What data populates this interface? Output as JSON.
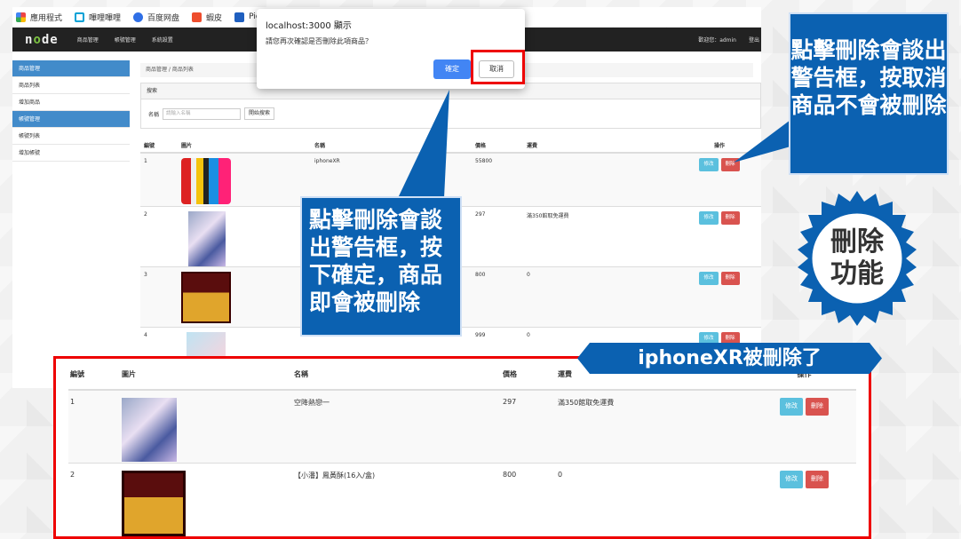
{
  "bookmarks": [
    "應用程式",
    "嗶哩嗶哩",
    "百度网盘",
    "蝦皮",
    "PicClick"
  ],
  "nav": {
    "logo": "node",
    "items": [
      "商品管理",
      "帳號管理",
      "系統設置"
    ],
    "user": "歡迎您：admin",
    "logout": "登出"
  },
  "sidebar": [
    "商品管理",
    "商品列表",
    "增加商品",
    "帳號管理",
    "帳號列表",
    "增加帳號"
  ],
  "breadcrumb": "商品管理 / 商品列表",
  "search": {
    "title": "搜索",
    "label": "名稱",
    "placeholder": "請輸入名稱",
    "button": "開始搜索"
  },
  "table": {
    "headers": [
      "編號",
      "圖片",
      "名稱",
      "價格",
      "運費",
      "操作"
    ],
    "rows": [
      {
        "id": "1",
        "name": "iphoneXR",
        "price": "55800",
        "ship": ""
      },
      {
        "id": "2",
        "name": "",
        "price": "297",
        "ship": "滿350館取免運費"
      },
      {
        "id": "3",
        "name": "",
        "price": "800",
        "ship": "0"
      },
      {
        "id": "4",
        "name": "",
        "price": "999",
        "ship": "0"
      }
    ],
    "edit": "修改",
    "del": "刪除"
  },
  "dialog": {
    "title": "localhost:3000 顯示",
    "message": "請您再次確認是否刪除此項商品？",
    "ok": "確定",
    "cancel": "取消"
  },
  "callout_right": "點擊刪除會談出警告框，按取消商品不會被刪除",
  "callout_center": "點擊刪除會談出警告框，按下確定，商品即會被刪除",
  "badge": {
    "line1": "刪除",
    "line2": "功能"
  },
  "ribbon": "iphoneXR被刪除了",
  "result": {
    "rows": [
      {
        "id": "1",
        "name": "空降熱戀一",
        "price": "297",
        "ship": "滿350館取免運費"
      },
      {
        "id": "2",
        "name": "【小潘】鳳黃酥(16入/盒)",
        "price": "800",
        "ship": "0"
      }
    ]
  }
}
